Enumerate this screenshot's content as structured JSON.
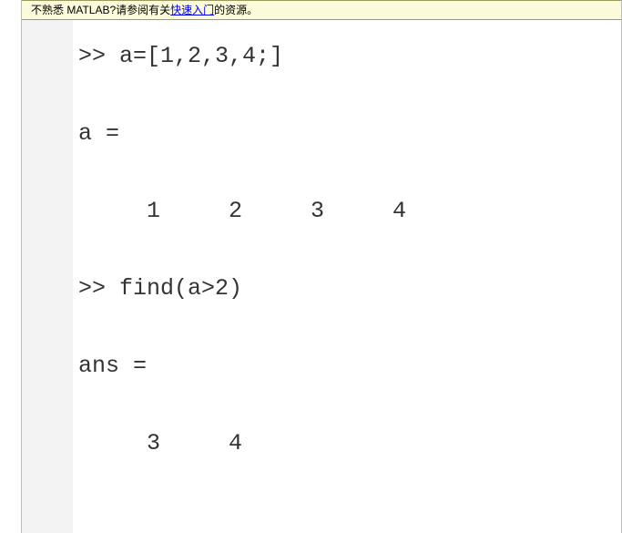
{
  "banner": {
    "prefix": "不熟悉 MATLAB?请参阅有关",
    "link_text": "快速入门",
    "suffix": "的资源。"
  },
  "console": {
    "prompt": ">> ",
    "lines": {
      "cmd1": "a=[1,2,3,4;]",
      "out1_label": "a =",
      "out1_values": "     1     2     3     4",
      "cmd2": "find(a>2)",
      "out2_label": "ans =",
      "out2_values": "     3     4"
    }
  }
}
